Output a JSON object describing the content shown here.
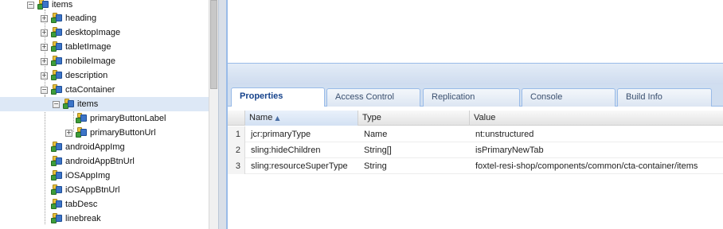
{
  "tree": {
    "nodes": [
      {
        "label": "items",
        "toggle": "−"
      },
      {
        "label": "heading",
        "toggle": "+"
      },
      {
        "label": "desktopImage",
        "toggle": "+"
      },
      {
        "label": "tabletImage",
        "toggle": "+"
      },
      {
        "label": "mobileImage",
        "toggle": "+"
      },
      {
        "label": "description",
        "toggle": "+"
      },
      {
        "label": "ctaContainer",
        "toggle": "−"
      },
      {
        "label": "items",
        "toggle": "−"
      },
      {
        "label": "primaryButtonLabel",
        "toggle": ""
      },
      {
        "label": "primaryButtonUrl",
        "toggle": "+"
      },
      {
        "label": "androidAppImg",
        "toggle": ""
      },
      {
        "label": "androidAppBtnUrl",
        "toggle": ""
      },
      {
        "label": "iOSAppImg",
        "toggle": ""
      },
      {
        "label": "iOSAppBtnUrl",
        "toggle": ""
      },
      {
        "label": "tabDesc",
        "toggle": ""
      },
      {
        "label": "linebreak",
        "toggle": ""
      }
    ]
  },
  "tabs": [
    "Properties",
    "Access Control",
    "Replication",
    "Console",
    "Build Info"
  ],
  "grid": {
    "columns": [
      "Name",
      "Type",
      "Value"
    ],
    "sort_indicator": "▲",
    "rows": [
      {
        "num": "1",
        "name": "jcr:primaryType",
        "type": "Name",
        "value": "nt:unstructured"
      },
      {
        "num": "2",
        "name": "sling:hideChildren",
        "type": "String[]",
        "value": "isPrimaryNewTab"
      },
      {
        "num": "3",
        "name": "sling:resourceSuperType",
        "type": "String",
        "value": "foxtel-resi-shop/components/common/cta-container/items"
      }
    ]
  }
}
